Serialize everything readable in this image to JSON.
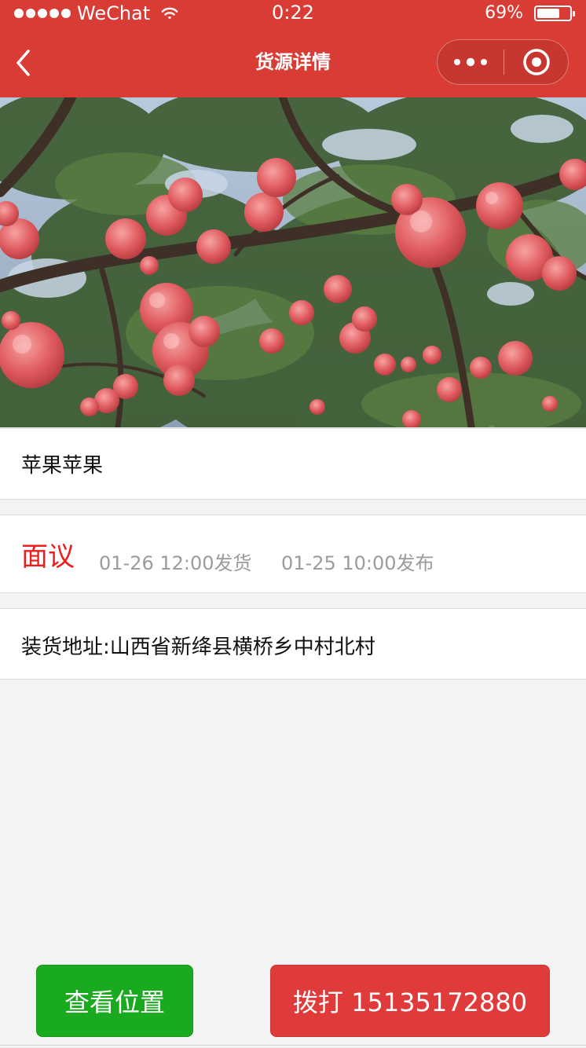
{
  "status_bar": {
    "carrier": "WeChat",
    "time": "0:22",
    "battery": "69%",
    "battery_level": 0.69
  },
  "nav": {
    "title": "货源详情",
    "icons": {
      "back": "chevron-left-icon",
      "more": "more-dots-icon",
      "close": "target-close-icon"
    }
  },
  "hero": {
    "image": "apple-tree-photo"
  },
  "goods": {
    "title": "苹果苹果",
    "price": "面议",
    "ship_time": "01-26 12:00发货",
    "publish_time": "01-25 10:00发布",
    "address": "装货地址:山西省新绛县横桥乡中村北村"
  },
  "actions": {
    "location_label": "查看位置",
    "call_label": "拨打 15135172880"
  },
  "colors": {
    "header": "#d93b35",
    "price": "#ee1c1c",
    "location_button": "#1aaa1f",
    "call_button": "#e03b3b"
  }
}
